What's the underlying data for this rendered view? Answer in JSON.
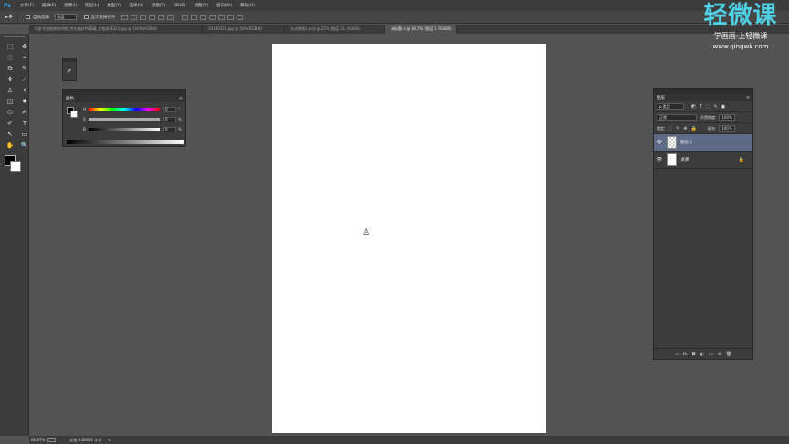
{
  "menubar": {
    "logo": "Ps",
    "items": [
      "文件(F)",
      "编辑(E)",
      "图像(I)",
      "图层(L)",
      "类型(Y)",
      "选择(S)",
      "滤镜(T)",
      "3D(D)",
      "视图(V)",
      "窗口(W)",
      "帮助(H)"
    ]
  },
  "options": {
    "tool_glyph": "▸✥",
    "auto_select_label": "自动选择:",
    "auto_select_value": "图层",
    "transform_label": "显示变换控件"
  },
  "tabs": [
    {
      "label": "Q版-世他图明对四图_色头猫好PS收藏_伦猫进线223.jpg @ 100%(RGB/8)",
      "active": false
    },
    {
      "label": "20180326.jpg @ 50%(RGB/8)",
      "active": false
    },
    {
      "label": "凡动物线1.psd @ 25% (图层 22, RGB/8)",
      "active": false
    },
    {
      "label": "未标题-4 @ 66.7% (图层 1, RGB/8)",
      "active": true
    }
  ],
  "tools": [
    "⬚",
    "✥",
    "◌",
    "⌖",
    "⧉",
    "✎",
    "✚",
    "⟋",
    "♙",
    "✦",
    "◫",
    "✸",
    "⬭",
    "✍",
    "✐",
    "T",
    "↖",
    "▭",
    "✋",
    "🔍"
  ],
  "mini_panel": {
    "icon": "✐"
  },
  "color_panel": {
    "tab": "颜色",
    "menu": "≡",
    "sliders": [
      {
        "label": "H",
        "value": "0",
        "unit": "°",
        "gradient": "linear-gradient(to right, #f00, #ff0, #0f0, #0ff, #00f, #f0f, #f00)"
      },
      {
        "label": "S",
        "value": "0",
        "unit": "%",
        "gradient": "linear-gradient(to right, #aaa, #aaa)"
      },
      {
        "label": "B",
        "value": "0",
        "unit": "%",
        "gradient": "linear-gradient(to right, #000, #fff)"
      }
    ]
  },
  "canvas": {
    "cursor": "♙"
  },
  "layers_panel": {
    "tab": "图层",
    "menu": "≡",
    "kind_label": "ρ 类型",
    "filter_icons": [
      "◩",
      "T",
      "⬚",
      "✎",
      "●"
    ],
    "blend_mode": "正常",
    "opacity_label": "不透明度:",
    "opacity_value": "100%",
    "lock_label": "锁定:",
    "lock_icons": [
      "⬚",
      "✎",
      "✥",
      "🔒"
    ],
    "fill_label": "填充:",
    "fill_value": "100%",
    "layers": [
      {
        "name": "图层 1",
        "selected": true,
        "italic": false,
        "locked": false,
        "checker": true
      },
      {
        "name": "背景",
        "selected": false,
        "italic": true,
        "locked": true,
        "checker": false
      }
    ],
    "footer_icons": [
      "∞",
      "fx",
      "◘",
      "◐",
      "▭",
      "⊕",
      "🗑"
    ]
  },
  "status": {
    "zoom": "66.67%",
    "doc_info": "文档:4.80M/0 字节",
    "arrow": "▸"
  },
  "watermark": {
    "big": "轻微课",
    "sub": "学画画·上轻微课",
    "url": "www.qingwk.com"
  }
}
